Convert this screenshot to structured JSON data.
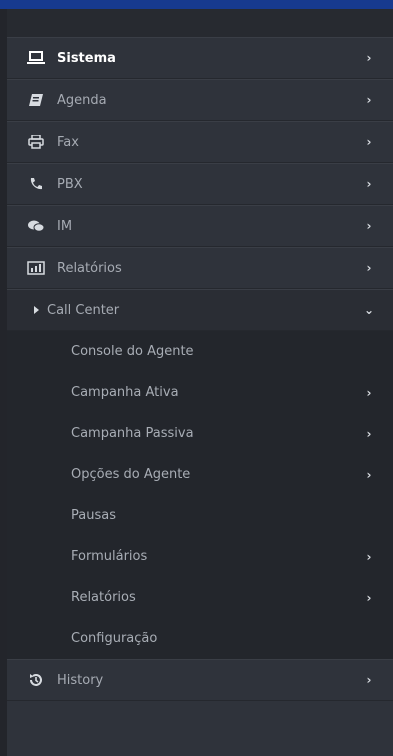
{
  "menu": {
    "items": [
      {
        "label": "Sistema",
        "icon": "laptop-icon",
        "arrow": "›",
        "active": true
      },
      {
        "label": "Agenda",
        "icon": "agenda-book-icon",
        "arrow": "›"
      },
      {
        "label": "Fax",
        "icon": "printer-icon",
        "arrow": "›"
      },
      {
        "label": "PBX",
        "icon": "phone-icon",
        "arrow": "›"
      },
      {
        "label": "IM",
        "icon": "chat-bubbles-icon",
        "arrow": "›"
      },
      {
        "label": "Relatórios",
        "icon": "report-chart-icon",
        "arrow": "›"
      },
      {
        "label": "Call Center",
        "icon": "caret-right-icon",
        "arrow": "⌄",
        "expanded": true
      }
    ],
    "call_center_submenu": [
      {
        "label": "Console do Agente",
        "arrow": ""
      },
      {
        "label": "Campanha Ativa",
        "arrow": "›"
      },
      {
        "label": "Campanha Passiva",
        "arrow": "›"
      },
      {
        "label": "Opções do Agente",
        "arrow": "›"
      },
      {
        "label": "Pausas",
        "arrow": ""
      },
      {
        "label": "Formulários",
        "arrow": "›"
      },
      {
        "label": "Relatórios",
        "arrow": "›"
      },
      {
        "label": "Configuração",
        "arrow": ""
      }
    ],
    "history": {
      "label": "History",
      "icon": "history-icon",
      "arrow": "›"
    }
  },
  "colors": {
    "topbar": "#173a8f",
    "sidebar_bg": "#2f333b",
    "submenu_bg": "#23262c",
    "text": "#a6abb3",
    "active_text": "#ffffff"
  }
}
